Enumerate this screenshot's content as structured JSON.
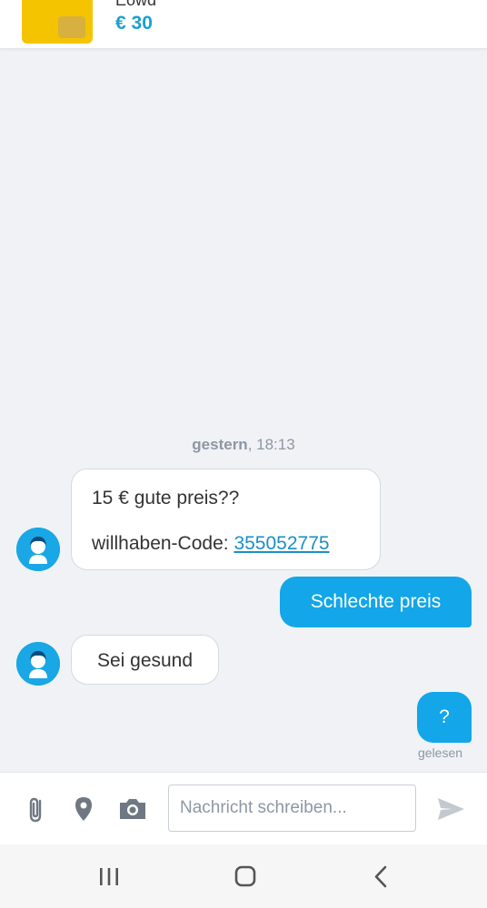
{
  "header": {
    "listing_title": "Eowd",
    "price": "€ 30"
  },
  "chat": {
    "date_day": "gestern",
    "date_time": ", 18:13",
    "messages": [
      {
        "text": "15 € gute preis??",
        "code_label": "willhaben-Code: ",
        "code_value": "355052775"
      },
      {
        "text": "Schlechte preis"
      },
      {
        "text": "Sei gesund"
      },
      {
        "text": "?"
      }
    ],
    "read_status": "gelesen"
  },
  "composer": {
    "placeholder": "Nachricht schreiben..."
  },
  "colors": {
    "accent": "#13a6e8",
    "brand_price": "#1aa0cf",
    "background": "#f0f2f6"
  },
  "icons": [
    "paperclip-icon",
    "location-pin-icon",
    "camera-icon",
    "send-icon",
    "recent-apps-icon",
    "home-icon",
    "back-icon",
    "user-avatar-icon"
  ]
}
